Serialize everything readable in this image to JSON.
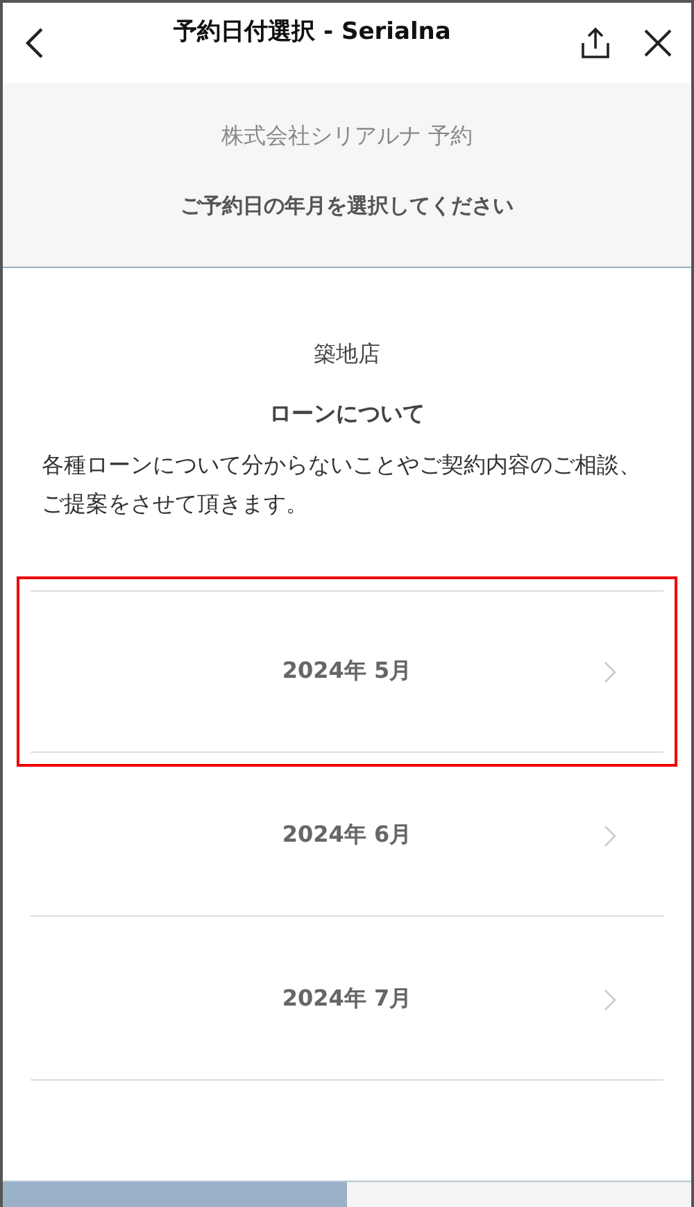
{
  "nav": {
    "title": "予約日付選択 - Serialna"
  },
  "header": {
    "company": "株式会社シリアルナ 予約",
    "instruction": "ご予約日の年月を選択してください"
  },
  "store": {
    "name": "築地店",
    "topic": "ローンについて",
    "description": "各種ローンについて分からないことやご契約内容のご相談、ご提案をさせて頂きます。"
  },
  "months": [
    {
      "label": "2024年 5月",
      "highlighted": true
    },
    {
      "label": "2024年 6月",
      "highlighted": false
    },
    {
      "label": "2024年 7月",
      "highlighted": false
    }
  ],
  "progress": {
    "level": 0.5
  }
}
